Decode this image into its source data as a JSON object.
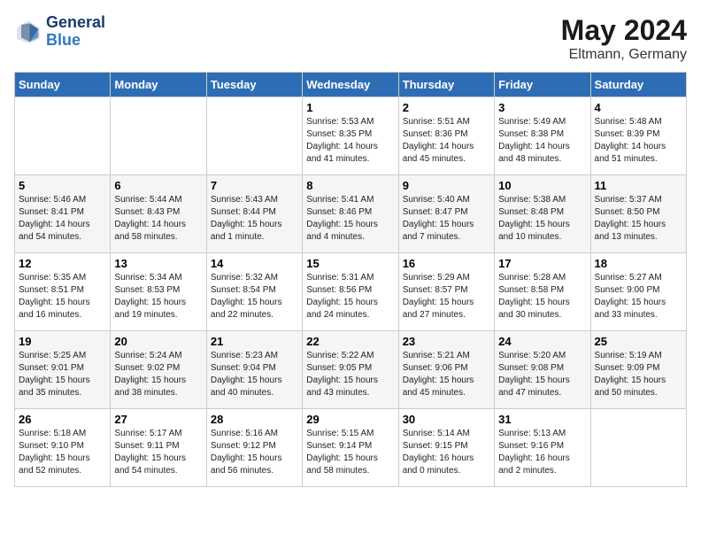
{
  "header": {
    "logo_line1": "General",
    "logo_line2": "Blue",
    "title": "May 2024",
    "subtitle": "Eltmann, Germany"
  },
  "days_of_week": [
    "Sunday",
    "Monday",
    "Tuesday",
    "Wednesday",
    "Thursday",
    "Friday",
    "Saturday"
  ],
  "weeks": [
    [
      {
        "day": "",
        "info": ""
      },
      {
        "day": "",
        "info": ""
      },
      {
        "day": "",
        "info": ""
      },
      {
        "day": "1",
        "info": "Sunrise: 5:53 AM\nSunset: 8:35 PM\nDaylight: 14 hours\nand 41 minutes."
      },
      {
        "day": "2",
        "info": "Sunrise: 5:51 AM\nSunset: 8:36 PM\nDaylight: 14 hours\nand 45 minutes."
      },
      {
        "day": "3",
        "info": "Sunrise: 5:49 AM\nSunset: 8:38 PM\nDaylight: 14 hours\nand 48 minutes."
      },
      {
        "day": "4",
        "info": "Sunrise: 5:48 AM\nSunset: 8:39 PM\nDaylight: 14 hours\nand 51 minutes."
      }
    ],
    [
      {
        "day": "5",
        "info": "Sunrise: 5:46 AM\nSunset: 8:41 PM\nDaylight: 14 hours\nand 54 minutes."
      },
      {
        "day": "6",
        "info": "Sunrise: 5:44 AM\nSunset: 8:43 PM\nDaylight: 14 hours\nand 58 minutes."
      },
      {
        "day": "7",
        "info": "Sunrise: 5:43 AM\nSunset: 8:44 PM\nDaylight: 15 hours\nand 1 minute."
      },
      {
        "day": "8",
        "info": "Sunrise: 5:41 AM\nSunset: 8:46 PM\nDaylight: 15 hours\nand 4 minutes."
      },
      {
        "day": "9",
        "info": "Sunrise: 5:40 AM\nSunset: 8:47 PM\nDaylight: 15 hours\nand 7 minutes."
      },
      {
        "day": "10",
        "info": "Sunrise: 5:38 AM\nSunset: 8:48 PM\nDaylight: 15 hours\nand 10 minutes."
      },
      {
        "day": "11",
        "info": "Sunrise: 5:37 AM\nSunset: 8:50 PM\nDaylight: 15 hours\nand 13 minutes."
      }
    ],
    [
      {
        "day": "12",
        "info": "Sunrise: 5:35 AM\nSunset: 8:51 PM\nDaylight: 15 hours\nand 16 minutes."
      },
      {
        "day": "13",
        "info": "Sunrise: 5:34 AM\nSunset: 8:53 PM\nDaylight: 15 hours\nand 19 minutes."
      },
      {
        "day": "14",
        "info": "Sunrise: 5:32 AM\nSunset: 8:54 PM\nDaylight: 15 hours\nand 22 minutes."
      },
      {
        "day": "15",
        "info": "Sunrise: 5:31 AM\nSunset: 8:56 PM\nDaylight: 15 hours\nand 24 minutes."
      },
      {
        "day": "16",
        "info": "Sunrise: 5:29 AM\nSunset: 8:57 PM\nDaylight: 15 hours\nand 27 minutes."
      },
      {
        "day": "17",
        "info": "Sunrise: 5:28 AM\nSunset: 8:58 PM\nDaylight: 15 hours\nand 30 minutes."
      },
      {
        "day": "18",
        "info": "Sunrise: 5:27 AM\nSunset: 9:00 PM\nDaylight: 15 hours\nand 33 minutes."
      }
    ],
    [
      {
        "day": "19",
        "info": "Sunrise: 5:25 AM\nSunset: 9:01 PM\nDaylight: 15 hours\nand 35 minutes."
      },
      {
        "day": "20",
        "info": "Sunrise: 5:24 AM\nSunset: 9:02 PM\nDaylight: 15 hours\nand 38 minutes."
      },
      {
        "day": "21",
        "info": "Sunrise: 5:23 AM\nSunset: 9:04 PM\nDaylight: 15 hours\nand 40 minutes."
      },
      {
        "day": "22",
        "info": "Sunrise: 5:22 AM\nSunset: 9:05 PM\nDaylight: 15 hours\nand 43 minutes."
      },
      {
        "day": "23",
        "info": "Sunrise: 5:21 AM\nSunset: 9:06 PM\nDaylight: 15 hours\nand 45 minutes."
      },
      {
        "day": "24",
        "info": "Sunrise: 5:20 AM\nSunset: 9:08 PM\nDaylight: 15 hours\nand 47 minutes."
      },
      {
        "day": "25",
        "info": "Sunrise: 5:19 AM\nSunset: 9:09 PM\nDaylight: 15 hours\nand 50 minutes."
      }
    ],
    [
      {
        "day": "26",
        "info": "Sunrise: 5:18 AM\nSunset: 9:10 PM\nDaylight: 15 hours\nand 52 minutes."
      },
      {
        "day": "27",
        "info": "Sunrise: 5:17 AM\nSunset: 9:11 PM\nDaylight: 15 hours\nand 54 minutes."
      },
      {
        "day": "28",
        "info": "Sunrise: 5:16 AM\nSunset: 9:12 PM\nDaylight: 15 hours\nand 56 minutes."
      },
      {
        "day": "29",
        "info": "Sunrise: 5:15 AM\nSunset: 9:14 PM\nDaylight: 15 hours\nand 58 minutes."
      },
      {
        "day": "30",
        "info": "Sunrise: 5:14 AM\nSunset: 9:15 PM\nDaylight: 16 hours\nand 0 minutes."
      },
      {
        "day": "31",
        "info": "Sunrise: 5:13 AM\nSunset: 9:16 PM\nDaylight: 16 hours\nand 2 minutes."
      },
      {
        "day": "",
        "info": ""
      }
    ]
  ]
}
